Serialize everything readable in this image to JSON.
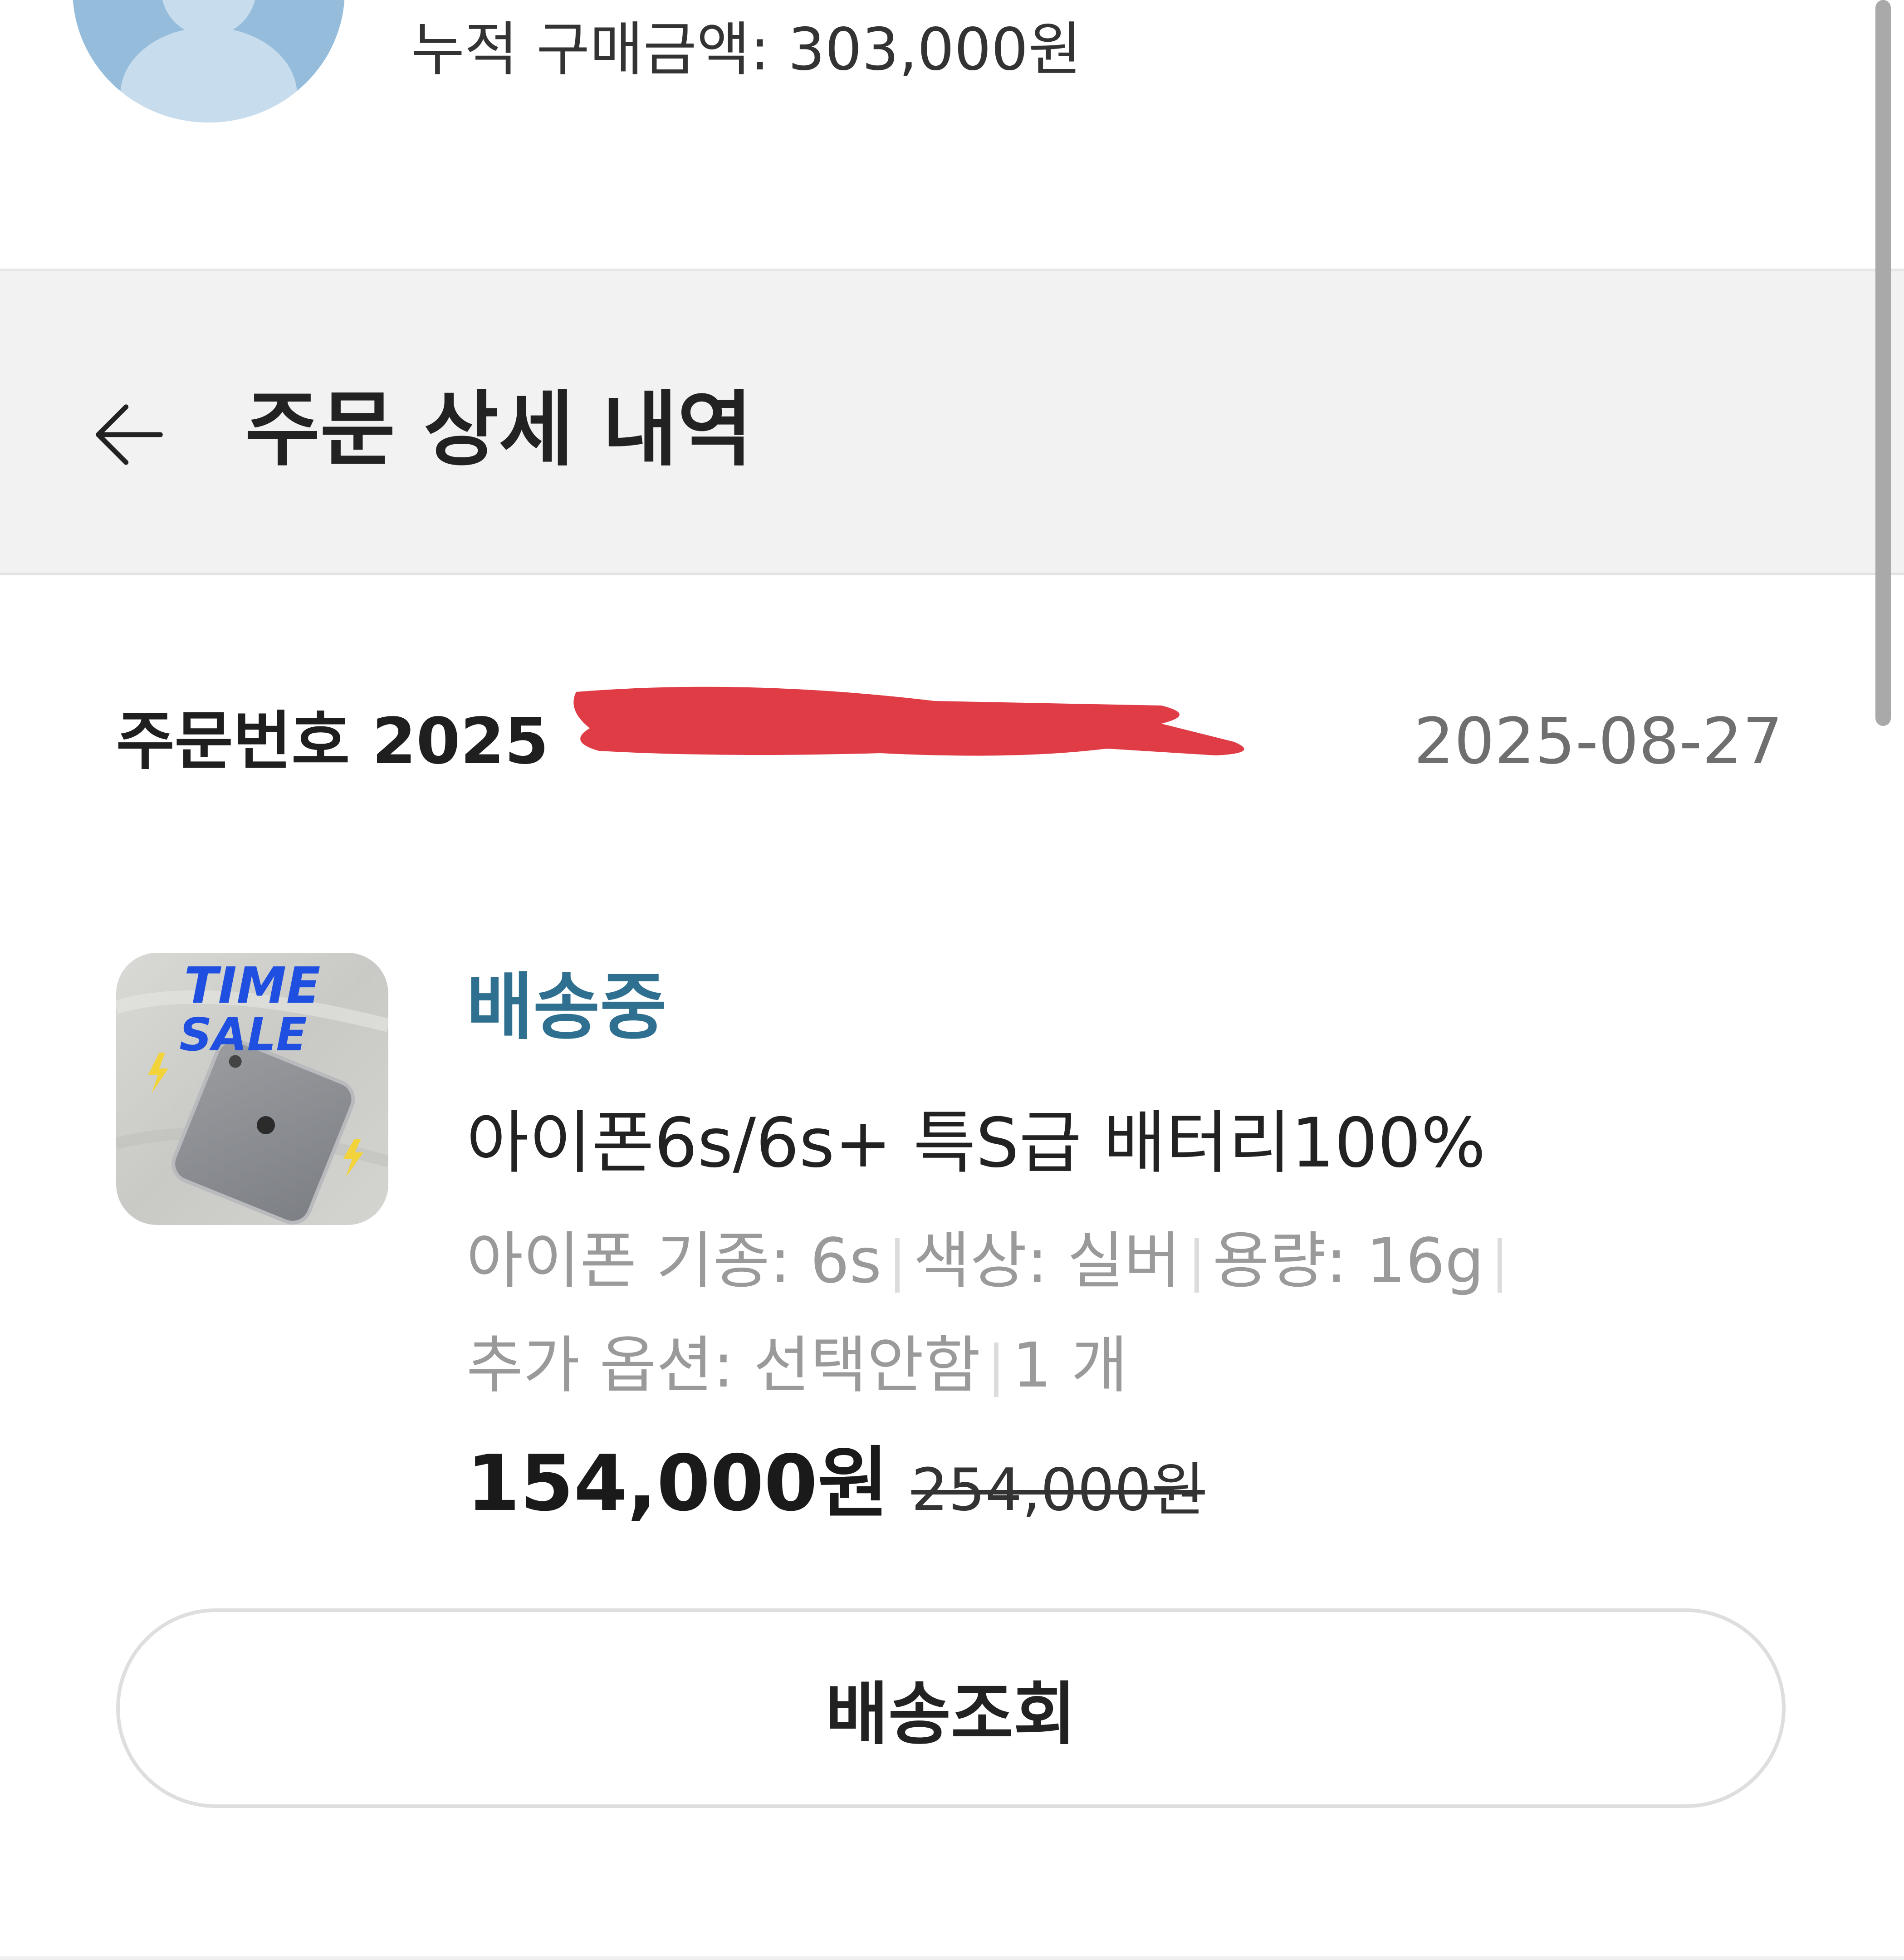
{
  "profile": {
    "total_purchase_label": "누적 구매금액: 303,000원"
  },
  "header": {
    "title": "주문 상세 내역"
  },
  "order": {
    "number_label": "주문번호 2025",
    "date": "2025-08-27"
  },
  "product": {
    "thumbnail_text_1": "TIME",
    "thumbnail_text_2": "SALE",
    "status": "배송중",
    "name": "아이폰6s/6s+ 특S급 배터리100%",
    "options_line1": {
      "model": "아이폰 기종: 6s",
      "color": "색상: 실버",
      "capacity": "용량: 16g"
    },
    "options_line2": {
      "extra": "추가 옵션: 선택안함",
      "quantity": "1 개"
    },
    "price": "154,000원",
    "original_price": "254,000원"
  },
  "actions": {
    "track_label": "배송조회"
  },
  "colors": {
    "status": "#2f6f90",
    "header_bg": "#f2f2f2",
    "avatar": "#95bddb",
    "redaction": "#e03c45"
  },
  "icons": {
    "back": "arrow-left-icon",
    "avatar": "user-avatar-icon"
  }
}
